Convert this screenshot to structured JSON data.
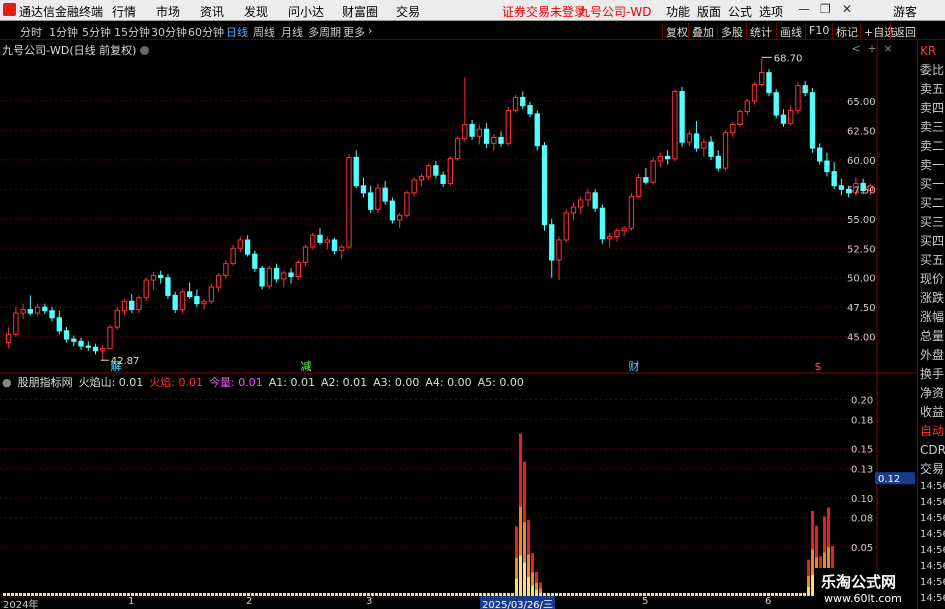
{
  "titlebar": {
    "app_name": "通达信金融终端",
    "menu": [
      "行情",
      "市场",
      "资讯",
      "发现",
      "问小达",
      "财富圈",
      "交易"
    ],
    "notice": "证券交易未登录",
    "stock_title": "九号公司-WD",
    "right_menu": [
      "功能",
      "版面",
      "公式",
      "选项"
    ],
    "user": "游客"
  },
  "periods": [
    "分时",
    "1分钟",
    "5分钟",
    "15分钟",
    "30分钟",
    "60分钟",
    "日线",
    "周线",
    "月线",
    "多周期",
    "更多"
  ],
  "active_period": "日线",
  "toolbar_right": [
    "复权",
    "叠加",
    "多股",
    "统计",
    "画线",
    "F10",
    "标记",
    "+自选",
    "返回"
  ],
  "stock_line": "九号公司-WD(日线 前复权)",
  "price_axis": [
    "65.00",
    "62.50",
    "60.00",
    "57.50",
    "55.00",
    "52.50",
    "50.00",
    "47.50",
    "45.00"
  ],
  "price_high_label": "68.70",
  "price_low_label": "42.87",
  "event_markers": [
    {
      "label": "解",
      "color": "#4ad8ff"
    },
    {
      "label": "减",
      "color": "#5f5"
    },
    {
      "label": "财",
      "color": "#4ad8ff"
    },
    {
      "label": "$",
      "color": "#f55"
    }
  ],
  "indicator": {
    "name": "股朋指标网",
    "items": [
      {
        "label": "火焰山: 0.01",
        "color": "#ddd"
      },
      {
        "label": "火焰: 0.01",
        "color": "#f33"
      },
      {
        "label": "今量: 0.01",
        "color": "#e5e"
      },
      {
        "label": "A1: 0.01",
        "color": "#ddd"
      },
      {
        "label": "A2: 0.01",
        "color": "#ddd"
      },
      {
        "label": "A3: 0.00",
        "color": "#ddd"
      },
      {
        "label": "A4: 0.00",
        "color": "#ddd"
      },
      {
        "label": "A5: 0.00",
        "color": "#ddd"
      }
    ],
    "axis": [
      "0.20",
      "0.18",
      "0.15",
      "0.13",
      "0.10",
      "0.08",
      "0.05"
    ],
    "current_value": "0.12"
  },
  "time_axis": [
    {
      "label": "2024年",
      "hl": false
    },
    {
      "label": "1",
      "hl": false
    },
    {
      "label": "2",
      "hl": false
    },
    {
      "label": "3",
      "hl": false
    },
    {
      "label": "2025/03/26/三",
      "hl": true
    },
    {
      "label": "5",
      "hl": false
    },
    {
      "label": "6",
      "hl": false
    }
  ],
  "side_panel": [
    "KR",
    "委比",
    "卖五",
    "卖四",
    "卖三",
    "卖二",
    "卖一",
    "买一",
    "买二",
    "买三",
    "买四",
    "买五",
    "现价",
    "涨跌",
    "涨幅",
    "总量",
    "外盘",
    "换手",
    "净资",
    "收益",
    "自动",
    "CDR",
    "交易",
    "14:56",
    "14:56",
    "14:56",
    "14:56",
    "14:56",
    "14:56",
    "14:56",
    "14:56"
  ],
  "watermark": {
    "title": "乐淘公式网",
    "url": "www.60lt.com"
  },
  "colors": {
    "up": "#ff3232",
    "down": "#54ffff",
    "grid": "#5a0000",
    "axis": "#ccc"
  },
  "chart_data": {
    "type": "candlestick",
    "price_ylim": [
      42.0,
      70.0
    ],
    "candles": [
      [
        44.5,
        45.8,
        44.0,
        45.2
      ],
      [
        45.2,
        47.5,
        45.0,
        47.0
      ],
      [
        47.0,
        47.8,
        46.5,
        47.3
      ],
      [
        47.3,
        48.5,
        46.8,
        47.0
      ],
      [
        47.0,
        47.8,
        46.7,
        47.5
      ],
      [
        47.5,
        47.8,
        46.9,
        47.2
      ],
      [
        47.2,
        47.5,
        46.3,
        46.6
      ],
      [
        46.6,
        47.2,
        45.2,
        45.5
      ],
      [
        45.5,
        45.8,
        44.5,
        44.8
      ],
      [
        44.8,
        45.1,
        44.2,
        44.6
      ],
      [
        44.6,
        44.9,
        43.9,
        44.2
      ],
      [
        44.2,
        44.6,
        43.8,
        44.1
      ],
      [
        44.1,
        44.4,
        43.5,
        43.8
      ],
      [
        43.8,
        44.3,
        43.0,
        44.0
      ],
      [
        44.0,
        46.0,
        43.9,
        45.8
      ],
      [
        45.8,
        47.5,
        45.6,
        47.2
      ],
      [
        47.2,
        48.2,
        46.8,
        48.0
      ],
      [
        48.0,
        48.6,
        47.0,
        47.3
      ],
      [
        47.3,
        48.5,
        47.0,
        48.3
      ],
      [
        48.3,
        50.0,
        48.0,
        49.8
      ],
      [
        49.8,
        50.5,
        49.0,
        50.2
      ],
      [
        50.2,
        50.6,
        49.5,
        50.0
      ],
      [
        50.0,
        50.3,
        48.2,
        48.5
      ],
      [
        48.5,
        48.8,
        47.0,
        47.3
      ],
      [
        47.3,
        49.0,
        47.0,
        48.8
      ],
      [
        48.8,
        49.6,
        48.2,
        48.4
      ],
      [
        48.4,
        49.0,
        47.5,
        47.8
      ],
      [
        47.8,
        48.2,
        47.3,
        48.0
      ],
      [
        48.0,
        49.5,
        47.8,
        49.2
      ],
      [
        49.2,
        50.4,
        48.8,
        50.2
      ],
      [
        50.2,
        51.5,
        49.9,
        51.2
      ],
      [
        51.2,
        52.8,
        51.0,
        52.5
      ],
      [
        52.5,
        53.5,
        52.2,
        53.2
      ],
      [
        53.2,
        53.6,
        51.8,
        52.0
      ],
      [
        52.0,
        52.3,
        50.5,
        50.8
      ],
      [
        50.8,
        51.0,
        49.0,
        49.3
      ],
      [
        49.3,
        51.0,
        49.0,
        50.8
      ],
      [
        50.8,
        51.2,
        49.6,
        49.9
      ],
      [
        49.9,
        50.6,
        49.2,
        50.4
      ],
      [
        50.4,
        50.8,
        49.5,
        50.1
      ],
      [
        50.1,
        51.5,
        49.8,
        51.3
      ],
      [
        51.3,
        52.8,
        51.0,
        52.6
      ],
      [
        52.6,
        53.8,
        52.4,
        53.6
      ],
      [
        53.6,
        54.2,
        52.8,
        53.0
      ],
      [
        53.0,
        53.5,
        52.4,
        53.2
      ],
      [
        53.2,
        53.4,
        52.0,
        52.3
      ],
      [
        52.3,
        52.8,
        51.6,
        52.6
      ],
      [
        52.6,
        60.5,
        52.4,
        60.2
      ],
      [
        60.2,
        60.8,
        57.6,
        57.8
      ],
      [
        57.8,
        58.5,
        56.8,
        57.2
      ],
      [
        57.2,
        57.8,
        55.5,
        55.8
      ],
      [
        55.8,
        58.0,
        55.5,
        57.6
      ],
      [
        57.6,
        58.2,
        56.2,
        56.5
      ],
      [
        56.5,
        56.8,
        54.6,
        54.9
      ],
      [
        54.9,
        55.5,
        54.2,
        55.3
      ],
      [
        55.3,
        57.4,
        55.1,
        57.2
      ],
      [
        57.2,
        58.5,
        56.9,
        58.3
      ],
      [
        58.3,
        58.8,
        57.8,
        58.6
      ],
      [
        58.6,
        59.7,
        58.3,
        59.5
      ],
      [
        59.5,
        59.9,
        58.4,
        58.7
      ],
      [
        58.7,
        59.0,
        57.7,
        58.0
      ],
      [
        58.0,
        60.3,
        57.8,
        60.1
      ],
      [
        60.1,
        62.0,
        59.9,
        61.8
      ],
      [
        61.8,
        67.0,
        61.5,
        63.0
      ],
      [
        63.0,
        63.4,
        61.7,
        62.0
      ],
      [
        62.0,
        63.0,
        61.3,
        62.6
      ],
      [
        62.6,
        63.1,
        61.0,
        61.4
      ],
      [
        61.4,
        62.2,
        60.8,
        61.9
      ],
      [
        61.9,
        62.4,
        61.1,
        61.4
      ],
      [
        61.4,
        64.5,
        61.2,
        64.2
      ],
      [
        64.2,
        65.5,
        64.0,
        65.3
      ],
      [
        65.3,
        65.8,
        64.3,
        64.6
      ],
      [
        64.6,
        64.9,
        63.6,
        63.9
      ],
      [
        63.9,
        64.2,
        60.8,
        61.2
      ],
      [
        61.2,
        61.5,
        54.0,
        54.5
      ],
      [
        54.5,
        55.0,
        50.0,
        51.5
      ],
      [
        51.5,
        53.5,
        49.8,
        53.2
      ],
      [
        53.2,
        55.8,
        53.0,
        55.5
      ],
      [
        55.5,
        56.4,
        54.9,
        56.0
      ],
      [
        56.0,
        56.9,
        55.4,
        56.6
      ],
      [
        56.6,
        57.5,
        56.0,
        57.2
      ],
      [
        57.2,
        57.5,
        55.6,
        55.9
      ],
      [
        55.9,
        56.2,
        52.9,
        53.3
      ],
      [
        53.3,
        53.8,
        52.6,
        53.5
      ],
      [
        53.5,
        54.2,
        53.1,
        54.0
      ],
      [
        54.0,
        54.4,
        53.5,
        54.2
      ],
      [
        54.2,
        57.2,
        54.0,
        56.9
      ],
      [
        56.9,
        58.8,
        56.7,
        58.5
      ],
      [
        58.5,
        59.3,
        57.9,
        58.1
      ],
      [
        58.1,
        60.2,
        57.9,
        59.9
      ],
      [
        59.9,
        60.6,
        59.4,
        60.3
      ],
      [
        60.3,
        60.8,
        59.6,
        60.1
      ],
      [
        60.1,
        66.0,
        59.9,
        65.8
      ],
      [
        65.8,
        66.2,
        61.1,
        61.5
      ],
      [
        61.5,
        62.5,
        61.2,
        62.2
      ],
      [
        62.2,
        63.3,
        60.7,
        61.0
      ],
      [
        61.0,
        61.8,
        60.3,
        61.5
      ],
      [
        61.5,
        62.0,
        60.0,
        60.3
      ],
      [
        60.3,
        60.8,
        59.0,
        59.3
      ],
      [
        59.3,
        62.5,
        59.1,
        62.3
      ],
      [
        62.3,
        63.2,
        61.9,
        63.0
      ],
      [
        63.0,
        64.3,
        62.8,
        64.1
      ],
      [
        64.1,
        65.2,
        63.8,
        65.0
      ],
      [
        65.0,
        66.6,
        64.7,
        66.4
      ],
      [
        66.4,
        68.7,
        66.2,
        67.4
      ],
      [
        67.4,
        67.7,
        65.4,
        65.7
      ],
      [
        65.7,
        66.0,
        63.5,
        63.8
      ],
      [
        63.8,
        64.3,
        62.8,
        63.1
      ],
      [
        63.1,
        64.6,
        62.9,
        64.2
      ],
      [
        64.2,
        66.6,
        63.9,
        66.3
      ],
      [
        66.3,
        66.7,
        65.4,
        65.7
      ],
      [
        65.7,
        66.1,
        60.6,
        61.0
      ],
      [
        61.0,
        61.4,
        59.6,
        59.9
      ],
      [
        59.9,
        60.6,
        58.6,
        59.0
      ],
      [
        59.0,
        59.8,
        57.5,
        57.8
      ],
      [
        57.8,
        58.4,
        57.0,
        57.5
      ],
      [
        57.5,
        57.8,
        56.8,
        57.2
      ],
      [
        57.2,
        58.5,
        56.9,
        58.0
      ],
      [
        58.0,
        58.4,
        57.1,
        57.4
      ],
      [
        57.4,
        58.0,
        57.0,
        57.8
      ]
    ],
    "indicator_ylim": [
      0.0,
      0.22
    ],
    "indicator_peaks": [
      {
        "pos": 520,
        "value": 0.21
      },
      {
        "pos": 812,
        "value": 0.11
      },
      {
        "pos": 825,
        "value": 0.12
      }
    ]
  }
}
